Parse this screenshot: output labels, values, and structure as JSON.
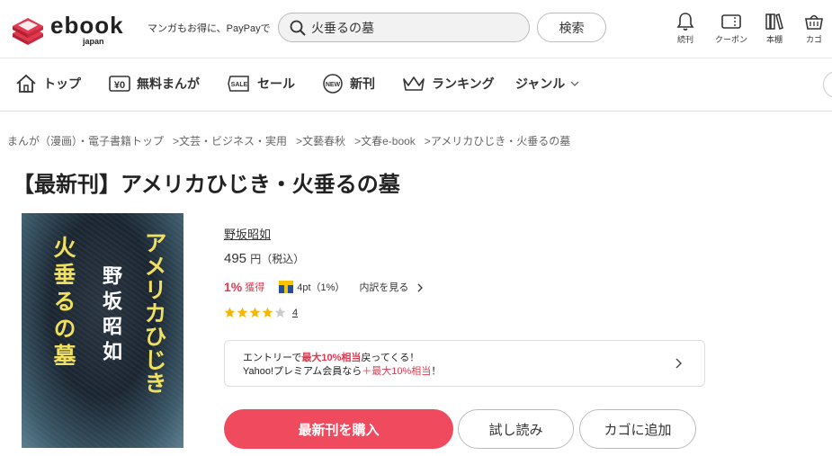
{
  "header": {
    "logo_word": "ebook",
    "logo_sub": "japan",
    "tagline": "マンガもお得に、PayPayで",
    "search": {
      "value": "火垂るの墓",
      "button": "検索"
    },
    "icons": [
      {
        "name": "bell-icon",
        "label": "続刊"
      },
      {
        "name": "coupon-icon",
        "label": "クーポン"
      },
      {
        "name": "bookshelf-icon",
        "label": "本棚"
      },
      {
        "name": "cart-icon",
        "label": "カゴ"
      }
    ]
  },
  "nav": {
    "items": [
      {
        "label": "トップ",
        "icon": "home-icon"
      },
      {
        "label": "無料まんが",
        "icon": "free-yen-icon"
      },
      {
        "label": "セール",
        "icon": "sale-icon"
      },
      {
        "label": "新刊",
        "icon": "new-icon"
      },
      {
        "label": "ランキング",
        "icon": "crown-icon"
      },
      {
        "label": "ジャンル",
        "icon": "chevron-down-icon"
      }
    ]
  },
  "breadcrumb": [
    "まんが（漫画）・電子書籍トップ",
    "文芸・ビジネス・実用",
    "文藝春秋",
    "文春e-book",
    "アメリカひじき・火垂るの墓"
  ],
  "breadcrumb_sep": ">",
  "product": {
    "title": "【最新刊】アメリカひじき・火垂るの墓",
    "cover": {
      "subtitle": "アメリカひじき",
      "author": "野坂昭如",
      "main_title": "火垂るの墓"
    },
    "author": "野坂昭如",
    "price": "495",
    "price_unit": "円（税込）",
    "points_pct": "1%",
    "points_earn": "獲得",
    "tpoint": "4pt（1%）",
    "points_detail": "内訳を見る",
    "rating": 4,
    "rating_max": 5,
    "review_count": "4"
  },
  "promo": {
    "line1_a": "エントリーで",
    "line1_b": "最大10%相当",
    "line1_c": "戻ってくる！",
    "line2_a": "Yahoo!プレミアム会員なら",
    "line2_b": "＋最大10%相当",
    "line2_c": "！"
  },
  "buttons": {
    "buy": "最新刊を購入",
    "trial": "試し読み",
    "cart": "カゴに追加"
  },
  "colors": {
    "accent": "#f04a5e",
    "logo_red": "#e0394f",
    "star": "#f5b800",
    "star_empty": "#cccccc"
  }
}
